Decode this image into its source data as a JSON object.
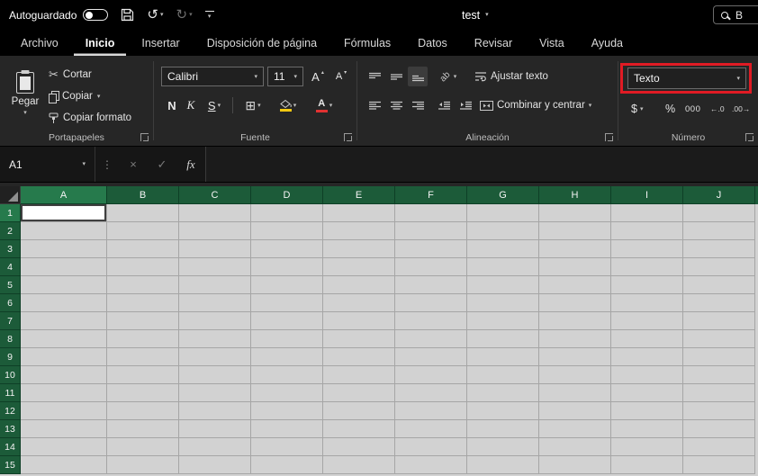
{
  "titlebar": {
    "autosave_label": "Autoguardado",
    "autosave_state": "off",
    "doc_title": "test",
    "search_text": "B"
  },
  "tabs": [
    {
      "label": "Archivo",
      "active": false
    },
    {
      "label": "Inicio",
      "active": true
    },
    {
      "label": "Insertar",
      "active": false
    },
    {
      "label": "Disposición de página",
      "active": false
    },
    {
      "label": "Fórmulas",
      "active": false
    },
    {
      "label": "Datos",
      "active": false
    },
    {
      "label": "Revisar",
      "active": false
    },
    {
      "label": "Vista",
      "active": false
    },
    {
      "label": "Ayuda",
      "active": false
    }
  ],
  "ribbon": {
    "clipboard": {
      "group_label": "Portapapeles",
      "paste": "Pegar",
      "cut": "Cortar",
      "copy": "Copiar",
      "format_painter": "Copiar formato"
    },
    "font": {
      "group_label": "Fuente",
      "family": "Calibri",
      "size": "11",
      "grow": "A",
      "shrink": "A",
      "bold": "N",
      "italic": "K",
      "underline": "S",
      "color_letter": "A"
    },
    "alignment": {
      "group_label": "Alineación",
      "wrap_text": "Ajustar texto",
      "merge_center": "Combinar y centrar"
    },
    "number": {
      "group_label": "Número",
      "format": "Texto",
      "currency": "$",
      "percent": "%",
      "thousands": "000",
      "increase_decimal": "←.0",
      "decrease_decimal": ".00→"
    }
  },
  "formula_bar": {
    "name_box": "A1",
    "fx_label": "fx"
  },
  "grid": {
    "columns": [
      "A",
      "B",
      "C",
      "D",
      "E",
      "F",
      "G",
      "H",
      "I",
      "J"
    ],
    "rows": [
      "1",
      "2",
      "3",
      "4",
      "5",
      "6",
      "7",
      "8",
      "9",
      "10",
      "11",
      "12",
      "13",
      "14",
      "15"
    ],
    "active_cell": "A1"
  },
  "icons": {
    "dropdown": "▾",
    "up_caret": "▴",
    "cut": "✂",
    "undo": "↺",
    "redo": "↻",
    "ellipsis": "⋮",
    "cancel": "×",
    "enter": "✓",
    "borders": "⊞",
    "orientation": "ab"
  },
  "colors": {
    "header_green": "#1c5b39",
    "header_green_active": "#267a4c",
    "annotation_red": "#e01b24",
    "fill_yellow": "#f2c811",
    "font_color_red": "#e03131"
  }
}
